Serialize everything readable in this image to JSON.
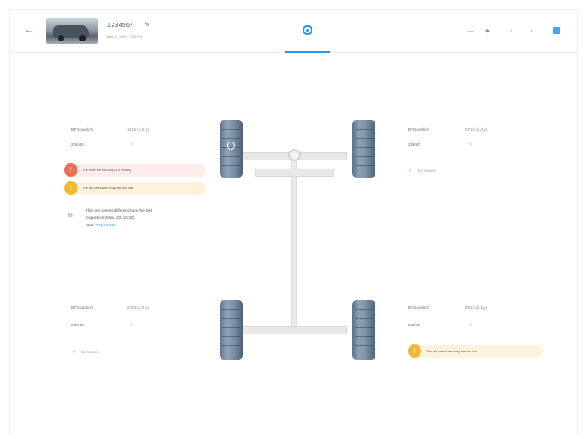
{
  "header": {
    "plate": "1234567",
    "date": "May 3, 2019, 2:25 PM",
    "colors": {
      "accent": "#2196f3"
    },
    "icons": [
      "back-arrow-icon",
      "pencil-icon",
      "tire-tab-icon",
      "minus-icon",
      "tag-icon",
      "chevron-left-icon",
      "chevron-right-icon",
      "grid-view-icon"
    ]
  },
  "tires": {
    "front_left": {
      "brand": "BFGoodrich",
      "dim": "1915 (3.5 y)",
      "size": "235/40",
      "warnings": [
        {
          "text": "The may be too old (3.5 years).",
          "color": "#f06b55"
        },
        {
          "text": "The air pressure may be too low.",
          "color": "#f5b731"
        }
      ],
      "diff": {
        "line1": "This tire seems different from the last",
        "line2": "inspection (Mon, 22, 15:22)",
        "see": "SEE",
        "link": "PREVIOUS"
      }
    },
    "front_right": {
      "brand": "BFGoodrich",
      "dim": "0718 (1.2 y)",
      "size": "235/40",
      "status": "No issues"
    },
    "rear_left": {
      "brand": "BFGoodrich",
      "dim": "0718 (1.2 y)",
      "size": "235/40",
      "status": "No issues"
    },
    "rear_right": {
      "brand": "BFGoodrich",
      "dim": "2917 (2.2 y)",
      "size": "235/40",
      "warnings": [
        {
          "text": "The air pressure may be too low.",
          "color": "#f5b731"
        }
      ]
    }
  }
}
